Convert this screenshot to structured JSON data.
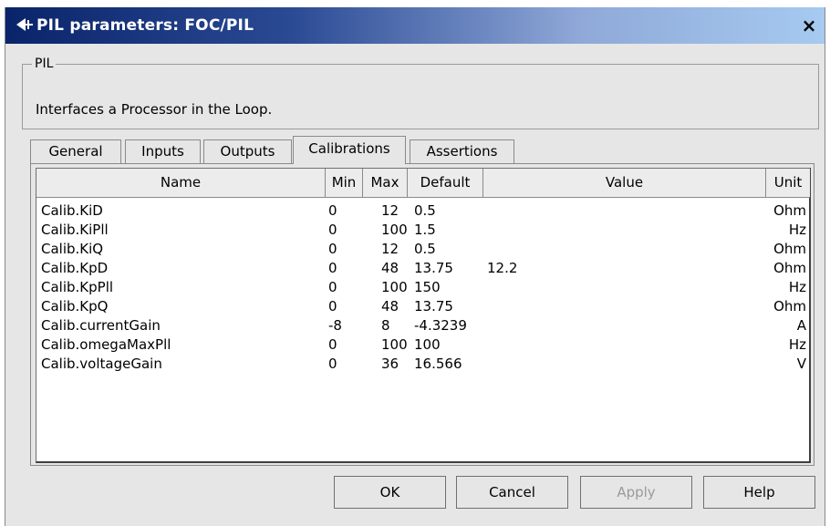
{
  "window": {
    "title": "PIL parameters: FOC/PIL",
    "close_label": "×"
  },
  "group": {
    "legend": "PIL",
    "description": "Interfaces a Processor in the Loop."
  },
  "tabs": [
    {
      "label": "General",
      "active": false
    },
    {
      "label": "Inputs",
      "active": false
    },
    {
      "label": "Outputs",
      "active": false
    },
    {
      "label": "Calibrations",
      "active": true
    },
    {
      "label": "Assertions",
      "active": false
    }
  ],
  "table": {
    "headers": {
      "name": "Name",
      "min": "Min",
      "max": "Max",
      "default": "Default",
      "value": "Value",
      "unit": "Unit"
    },
    "rows": [
      {
        "name": "Calib.KiD",
        "min": "0",
        "max": "12",
        "default": "0.5",
        "value": "",
        "unit": "Ohm"
      },
      {
        "name": "Calib.KiPll",
        "min": "0",
        "max": "100",
        "default": "1.5",
        "value": "",
        "unit": "Hz"
      },
      {
        "name": "Calib.KiQ",
        "min": "0",
        "max": "12",
        "default": "0.5",
        "value": "",
        "unit": "Ohm"
      },
      {
        "name": "Calib.KpD",
        "min": "0",
        "max": "48",
        "default": "13.75",
        "value": "12.2",
        "unit": "Ohm"
      },
      {
        "name": "Calib.KpPll",
        "min": "0",
        "max": "100",
        "default": "150",
        "value": "",
        "unit": "Hz"
      },
      {
        "name": "Calib.KpQ",
        "min": "0",
        "max": "48",
        "default": "13.75",
        "value": "",
        "unit": "Ohm"
      },
      {
        "name": "Calib.currentGain",
        "min": "-8",
        "max": "8",
        "default": "-4.3239",
        "value": "",
        "unit": "A"
      },
      {
        "name": "Calib.omegaMaxPll",
        "min": "0",
        "max": "100",
        "default": "100",
        "value": "",
        "unit": "Hz"
      },
      {
        "name": "Calib.voltageGain",
        "min": "0",
        "max": "36",
        "default": "16.566",
        "value": "",
        "unit": "V"
      }
    ]
  },
  "buttons": {
    "ok": "OK",
    "cancel": "Cancel",
    "apply": "Apply",
    "help": "Help"
  },
  "colors": {
    "title_start": "#0a246a",
    "title_end": "#a6caf0",
    "dialog_bg": "#e6e6e6",
    "disabled_text": "#9a9a9a"
  },
  "icons": {
    "app": "pil-block-icon",
    "close": "close-icon"
  }
}
